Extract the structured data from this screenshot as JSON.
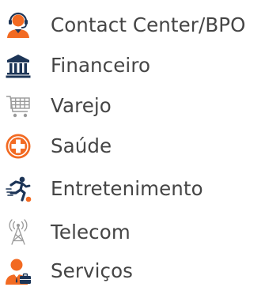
{
  "colors": {
    "accent": "#F26A22",
    "navy": "#1D3557",
    "gray": "#9A9A9A",
    "text": "#454545"
  },
  "menu": {
    "items": [
      {
        "label": "Contact Center/BPO",
        "icon": "headset-operator-icon"
      },
      {
        "label": "Financeiro",
        "icon": "bank-building-icon"
      },
      {
        "label": "Varejo",
        "icon": "shopping-cart-icon"
      },
      {
        "label": "Saúde",
        "icon": "medical-cross-icon"
      },
      {
        "label": "Entretenimento",
        "icon": "running-person-icon"
      },
      {
        "label": "Telecom",
        "icon": "antenna-tower-icon"
      },
      {
        "label": "Serviços",
        "icon": "business-person-icon"
      }
    ]
  }
}
